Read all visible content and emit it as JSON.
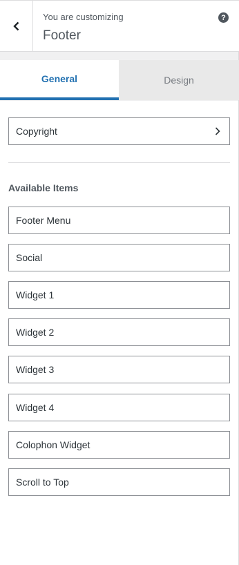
{
  "header": {
    "subtitle": "You are customizing",
    "title": "Footer",
    "help_glyph": "?"
  },
  "tabs": [
    {
      "label": "General",
      "active": true
    },
    {
      "label": "Design",
      "active": false
    }
  ],
  "copyright_label": "Copyright",
  "available_items": {
    "title": "Available Items",
    "items": [
      "Footer Menu",
      "Social",
      "Widget 1",
      "Widget 2",
      "Widget 3",
      "Widget 4",
      "Colophon Widget",
      "Scroll to Top"
    ]
  },
  "colors": {
    "accent": "#2271b1",
    "text_muted": "#50575e",
    "border": "#8c8f94"
  },
  "icons": [
    "chevron-left-icon",
    "help-icon",
    "chevron-right-icon"
  ]
}
